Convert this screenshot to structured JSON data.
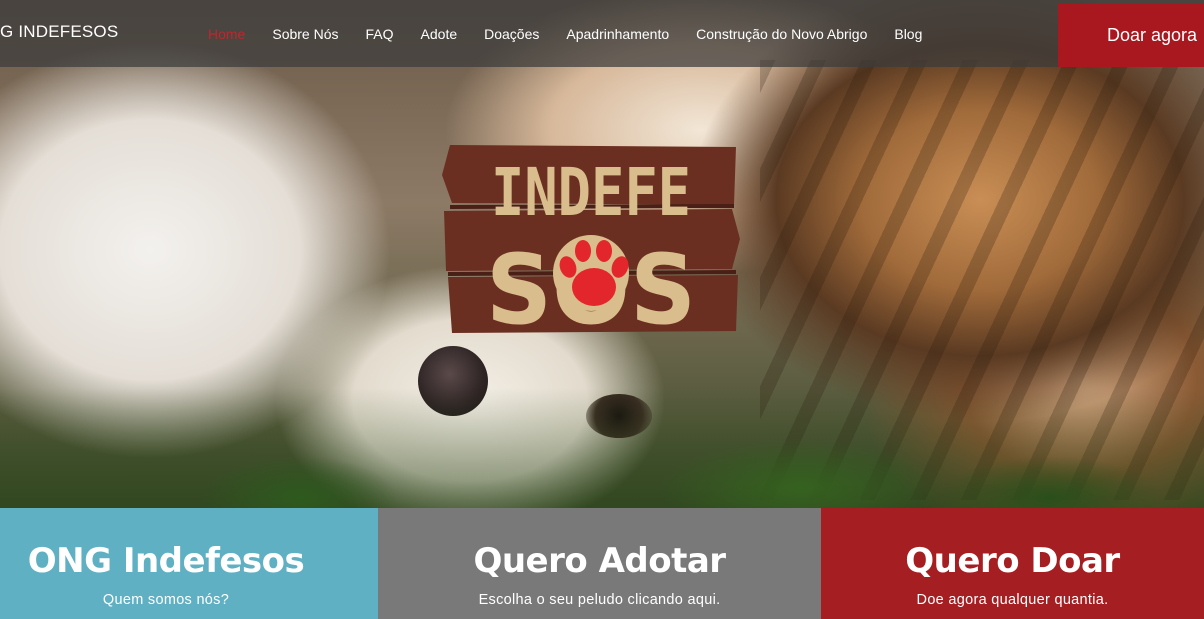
{
  "header": {
    "brand": "G INDEFESOS",
    "nav": [
      {
        "label": "Home",
        "active": true
      },
      {
        "label": "Sobre Nós",
        "active": false
      },
      {
        "label": "FAQ",
        "active": false
      },
      {
        "label": "Adote",
        "active": false
      },
      {
        "label": "Doações",
        "active": false
      },
      {
        "label": "Apadrinhamento",
        "active": false
      },
      {
        "label": "Construção do Novo Abrigo",
        "active": false
      },
      {
        "label": "Blog",
        "active": false
      }
    ],
    "donate_label": "Doar agora"
  },
  "hero": {
    "logo": {
      "line1": "INDEFE",
      "line2": "SOS",
      "icon": "paw-icon",
      "colors": {
        "wood": "#6b2f21",
        "letters": "#d9bd8c",
        "paw": "#e2262b"
      }
    }
  },
  "panels": [
    {
      "title": "ONG Indefesos",
      "subtitle": "Quem somos nós?",
      "color": "#5fb0c3"
    },
    {
      "title": "Quero Adotar",
      "subtitle": "Escolha o seu peludo clicando aqui.",
      "color": "#7a797a"
    },
    {
      "title": "Quero Doar",
      "subtitle": "Doe agora qualquer quantia.",
      "color": "#a51e22"
    }
  ],
  "colors": {
    "accent_red": "#a8181e",
    "active_nav": "#c0262b",
    "topbar": "#3c3c3c"
  }
}
